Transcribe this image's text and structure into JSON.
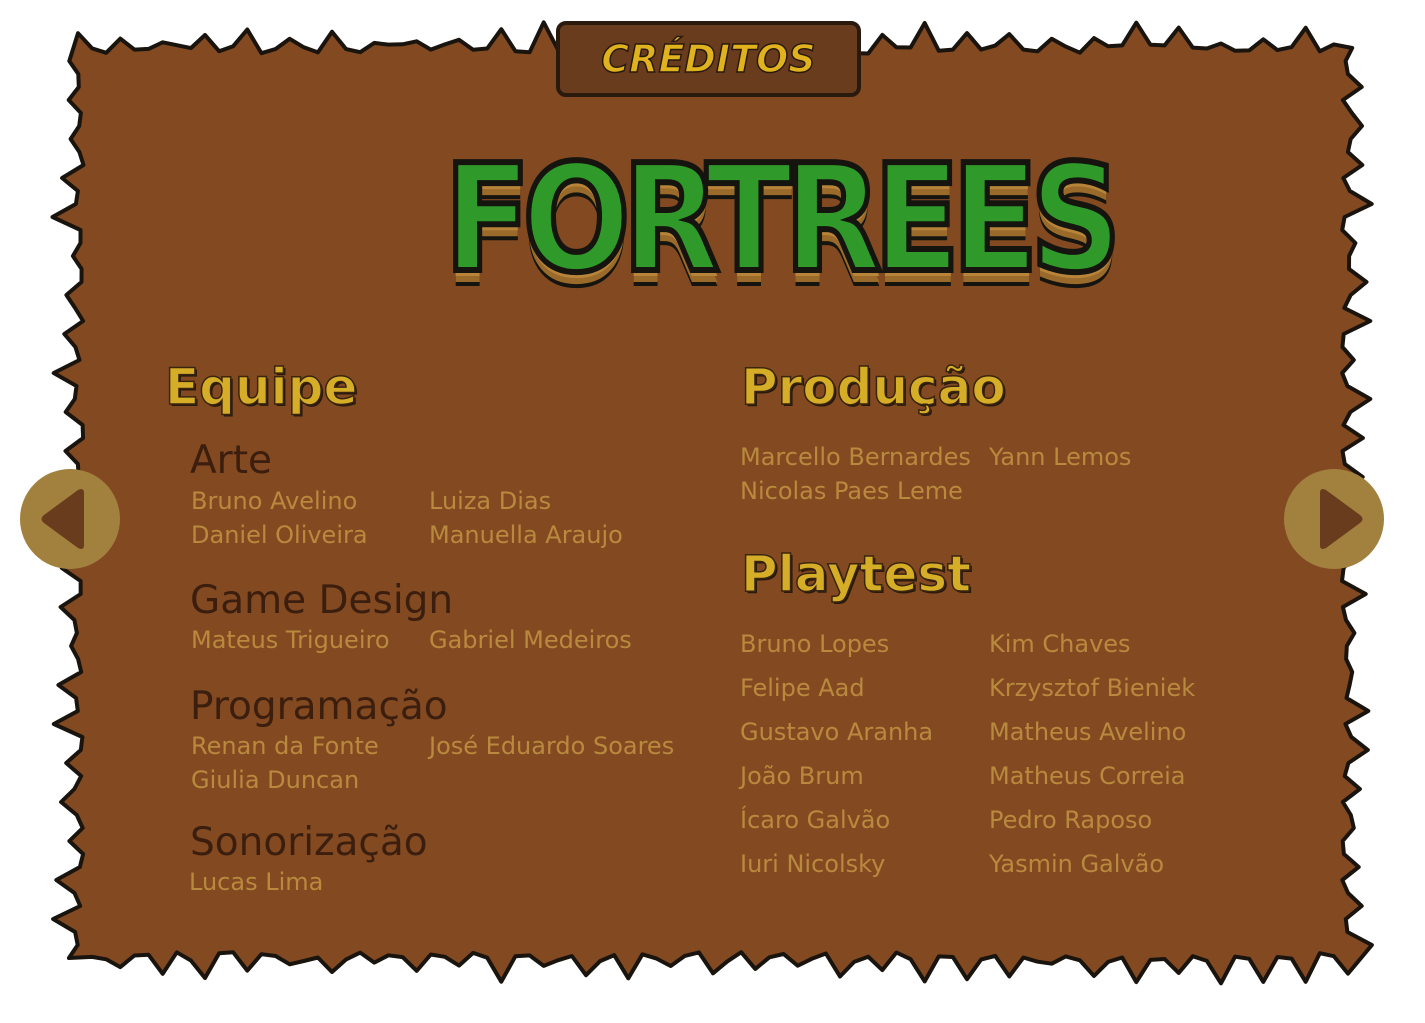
{
  "header": {
    "title": "CRÉDITOS"
  },
  "logo": {
    "text": "FORTREES"
  },
  "colors": {
    "board": "#834a22",
    "board_outline": "#1a140e",
    "heading": "#d6ad27",
    "subheading": "#3b1e0d",
    "name": "#b9893e",
    "nav_button": "#a2803e",
    "nav_arrow": "#6a3c1e",
    "logo_green": "#2f9a2a"
  },
  "equipe": {
    "heading": "Equipe",
    "groups": [
      {
        "title": "Arte",
        "names": [
          "Bruno Avelino",
          "Luiza Dias",
          "Daniel Oliveira",
          "Manuella Araujo"
        ]
      },
      {
        "title": "Game Design",
        "names": [
          "Mateus Trigueiro",
          "Gabriel Medeiros"
        ]
      },
      {
        "title": "Programação",
        "names": [
          "Renan da Fonte",
          "José Eduardo Soares",
          "Giulia Duncan"
        ]
      },
      {
        "title": "Sonorização",
        "names": [
          "Lucas Lima"
        ]
      }
    ]
  },
  "producao": {
    "heading": "Produção",
    "names": [
      "Marcello Bernardes",
      "Yann Lemos",
      "Nicolas Paes Leme"
    ]
  },
  "playtest": {
    "heading": "Playtest",
    "names": [
      "Bruno Lopes",
      "Kim Chaves",
      "Felipe Aad",
      "Krzysztof Bieniek",
      "Gustavo Aranha",
      "Matheus Avelino",
      "João Brum",
      "Matheus Correia",
      "Ícaro Galvão",
      "Pedro Raposo",
      "Iuri Nicolsky",
      "Yasmin Galvão"
    ]
  },
  "navigation": {
    "prev_icon": "arrow-left-icon",
    "next_icon": "arrow-right-icon"
  }
}
